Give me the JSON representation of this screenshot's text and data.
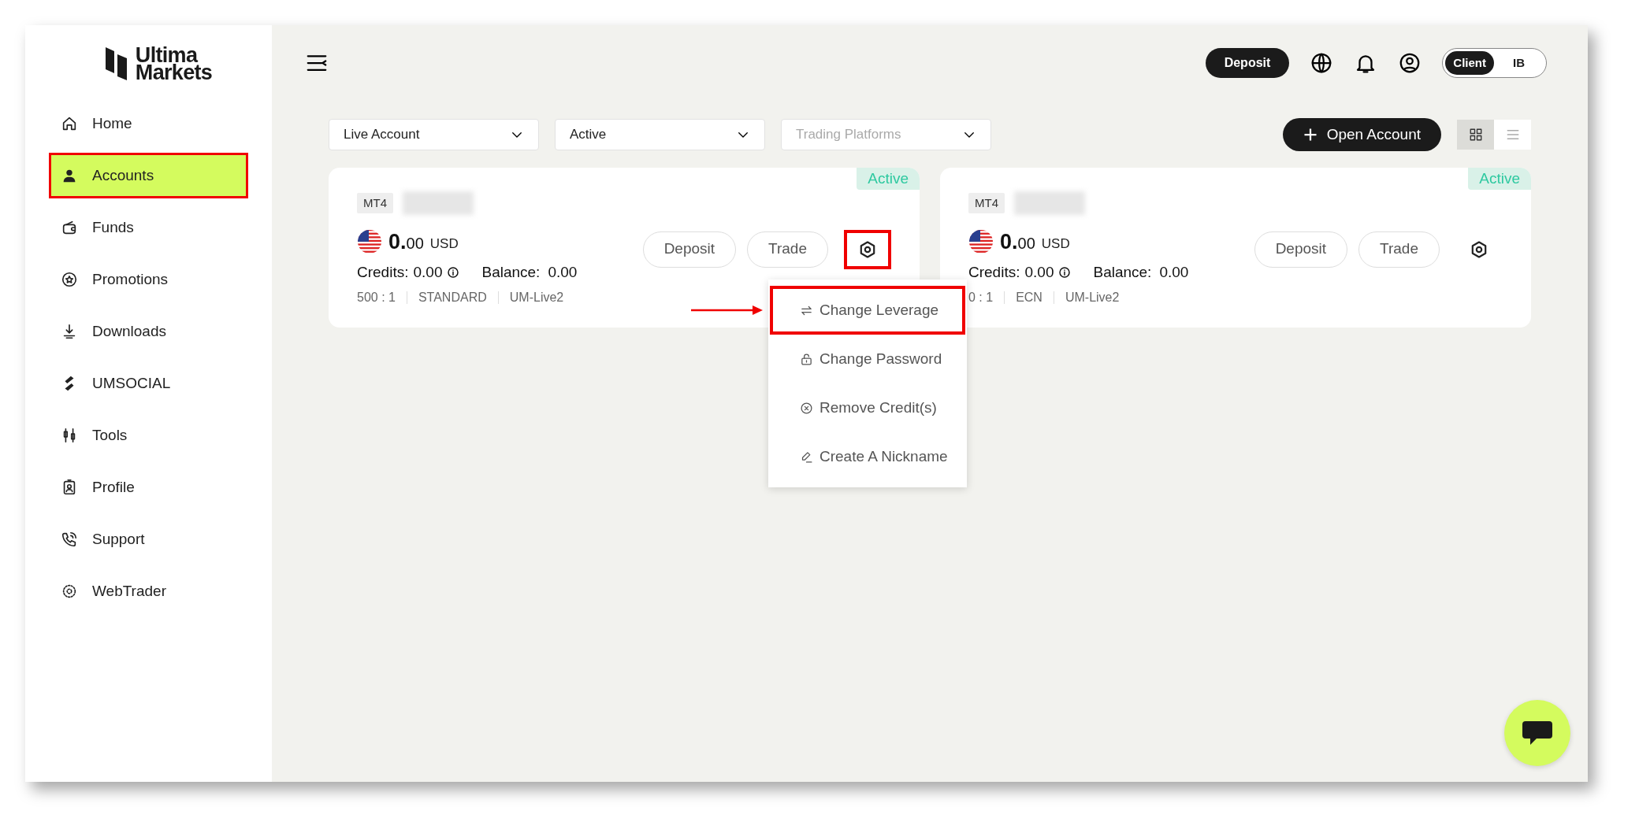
{
  "brand": {
    "name_line1": "Ultima",
    "name_line2": "Markets"
  },
  "sidebar": {
    "items": [
      {
        "label": "Home",
        "kind": "home",
        "selected": false,
        "highlighted": false
      },
      {
        "label": "Accounts",
        "kind": "user",
        "selected": true,
        "highlighted": true
      },
      {
        "label": "Funds",
        "kind": "wallet",
        "selected": false,
        "highlighted": false
      },
      {
        "label": "Promotions",
        "kind": "promo",
        "selected": false,
        "highlighted": false
      },
      {
        "label": "Downloads",
        "kind": "download",
        "selected": false,
        "highlighted": false
      },
      {
        "label": "UMSOCIAL",
        "kind": "social",
        "selected": false,
        "highlighted": false
      },
      {
        "label": "Tools",
        "kind": "tools",
        "selected": false,
        "highlighted": false
      },
      {
        "label": "Profile",
        "kind": "profile",
        "selected": false,
        "highlighted": false
      },
      {
        "label": "Support",
        "kind": "phone",
        "selected": false,
        "highlighted": false
      },
      {
        "label": "WebTrader",
        "kind": "web",
        "selected": false,
        "highlighted": false
      }
    ]
  },
  "header": {
    "deposit_button": "Deposit",
    "role_toggle": [
      {
        "label": "Client",
        "selected": true
      },
      {
        "label": "IB",
        "selected": false
      }
    ]
  },
  "filters": [
    {
      "value": "Live Account"
    },
    {
      "value": "Active"
    },
    {
      "placeholder": "Trading Platforms"
    }
  ],
  "open_account_button": "Open Account",
  "view_toggle": [
    {
      "kind": "grid",
      "selected": true
    },
    {
      "kind": "list",
      "selected": false
    }
  ],
  "accounts": [
    {
      "platform": "MT4",
      "status": "Active",
      "amount_whole": "0.",
      "amount_cents": "00",
      "currency": "USD",
      "credits_label": "Credits:",
      "credits": "0.00",
      "balance_label": "Balance:",
      "balance": "0.00",
      "leverage": "500 : 1",
      "type": "STANDARD",
      "server": "UM-Live2",
      "deposit": "Deposit",
      "trade": "Trade",
      "settings_highlighted": true
    },
    {
      "platform": "MT4",
      "status": "Active",
      "amount_whole": "0.",
      "amount_cents": "00",
      "currency": "USD",
      "credits_label": "Credits:",
      "credits": "0.00",
      "balance_label": "Balance:",
      "balance": "0.00",
      "leverage": "0 : 1",
      "type": "ECN",
      "server": "UM-Live2",
      "deposit": "Deposit",
      "trade": "Trade",
      "settings_highlighted": false
    }
  ],
  "settings_menu": {
    "items": [
      {
        "label": "Change Leverage",
        "kind": "swap",
        "highlighted": true
      },
      {
        "label": "Change Password",
        "kind": "lock",
        "highlighted": false
      },
      {
        "label": "Remove Credit(s)",
        "kind": "x",
        "highlighted": false
      },
      {
        "label": "Create A Nickname",
        "kind": "pen",
        "highlighted": false
      }
    ]
  }
}
